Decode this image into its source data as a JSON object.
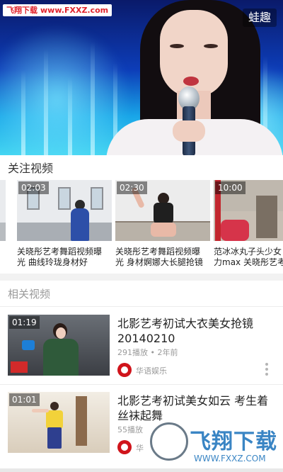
{
  "player": {
    "top_watermark_cn": "飞翔下载",
    "top_watermark_url": "www.FXXZ.com",
    "brand_badge": "蛙趣"
  },
  "follow_section": {
    "title": "关注视频",
    "cards": [
      {
        "duration": "02:03",
        "title_line1": "关晓彤艺考舞蹈视频曝",
        "title_line2": "光 曲线玲珑身材好"
      },
      {
        "duration": "02:30",
        "title_line1": "关晓彤艺考舞蹈视频曝",
        "title_line2": "光 身材婀娜大长腿抢镜"
      },
      {
        "duration": "10:00",
        "title_line1": "范冰冰丸子头少女",
        "title_line2": "力max 关晓彤艺考"
      }
    ]
  },
  "related_section": {
    "title": "相关视频",
    "items": [
      {
        "duration": "01:19",
        "title_line1": "北影艺考初试大衣美女抢镜",
        "title_line2": "20140210",
        "meta": "291播放 • 2年前",
        "author": "华语娱乐"
      },
      {
        "duration": "01:01",
        "title_line1": "北影艺考初试美女如云 考生着",
        "title_line2": "丝袜起舞",
        "meta": "55播放",
        "author": "华"
      }
    ]
  },
  "bottom_watermark": {
    "big": "飞翔下载",
    "small": "WWW.FXXZ.COM"
  },
  "colors": {
    "accent_red": "#e0222b",
    "watermark_blue": "#2a7bbf"
  }
}
